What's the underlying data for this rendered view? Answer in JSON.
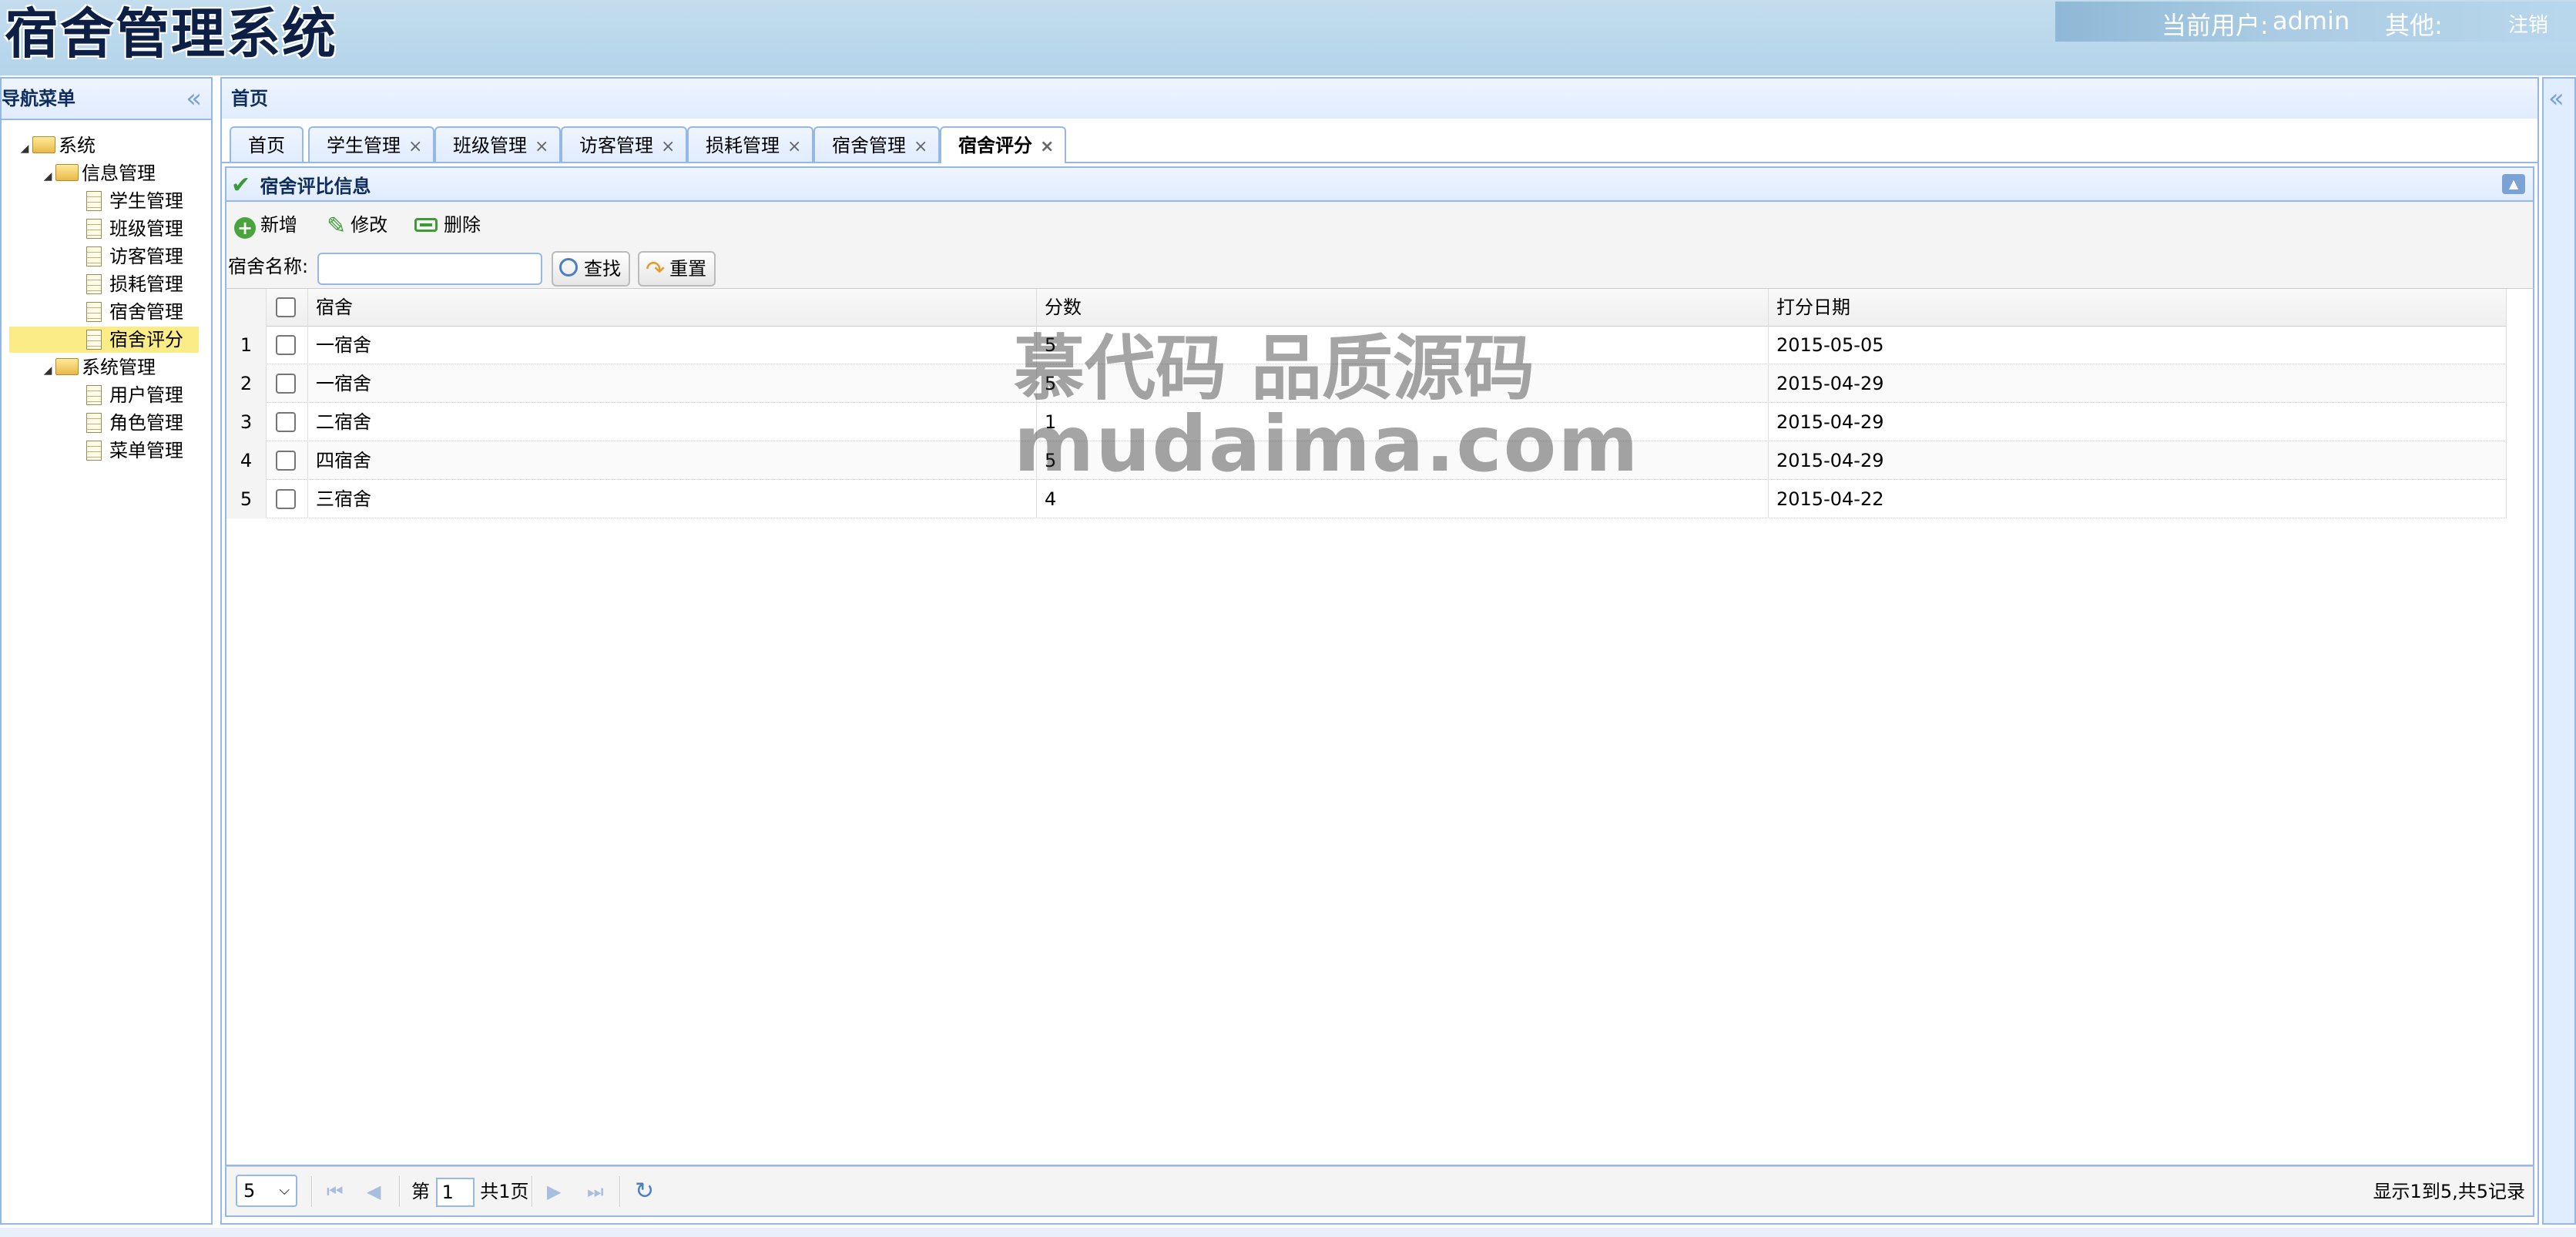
{
  "header": {
    "app_title": "宿舍管理系统",
    "current_user_label": "当前用户:",
    "current_user": "admin",
    "other_label": "其他:",
    "logout": "注销"
  },
  "nav": {
    "title": "导航菜单",
    "tree": [
      {
        "label": "系统",
        "type": "folder",
        "level": 0
      },
      {
        "label": "信息管理",
        "type": "folder",
        "level": 1
      },
      {
        "label": "学生管理",
        "type": "file",
        "level": 2
      },
      {
        "label": "班级管理",
        "type": "file",
        "level": 2
      },
      {
        "label": "访客管理",
        "type": "file",
        "level": 2
      },
      {
        "label": "损耗管理",
        "type": "file",
        "level": 2
      },
      {
        "label": "宿舍管理",
        "type": "file",
        "level": 2
      },
      {
        "label": "宿舍评分",
        "type": "file",
        "level": 2,
        "selected": true
      },
      {
        "label": "系统管理",
        "type": "folder",
        "level": 1
      },
      {
        "label": "用户管理",
        "type": "file",
        "level": 2
      },
      {
        "label": "角色管理",
        "type": "file",
        "level": 2
      },
      {
        "label": "菜单管理",
        "type": "file",
        "level": 2
      }
    ]
  },
  "center": {
    "title": "首页",
    "tabs": [
      {
        "label": "首页",
        "closable": false
      },
      {
        "label": "学生管理",
        "closable": true
      },
      {
        "label": "班级管理",
        "closable": true
      },
      {
        "label": "访客管理",
        "closable": true
      },
      {
        "label": "损耗管理",
        "closable": true
      },
      {
        "label": "宿舍管理",
        "closable": true
      },
      {
        "label": "宿舍评分",
        "closable": true,
        "active": true
      }
    ],
    "close_glyph": "×"
  },
  "panel": {
    "title": "宿舍评比信息",
    "toolbar": {
      "add": "新增",
      "edit": "修改",
      "delete": "删除"
    },
    "search": {
      "label": "宿舍名称:",
      "value": "",
      "search_btn": "查找",
      "reset_btn": "重置"
    }
  },
  "grid": {
    "columns": [
      "宿舍",
      "分数",
      "打分日期"
    ],
    "rows": [
      {
        "num": "1",
        "dorm": "一宿舍",
        "score": "5",
        "date": "2015-05-05"
      },
      {
        "num": "2",
        "dorm": "一宿舍",
        "score": "5",
        "date": "2015-04-29"
      },
      {
        "num": "3",
        "dorm": "二宿舍",
        "score": "1",
        "date": "2015-04-29"
      },
      {
        "num": "4",
        "dorm": "四宿舍",
        "score": "5",
        "date": "2015-04-29"
      },
      {
        "num": "5",
        "dorm": "三宿舍",
        "score": "4",
        "date": "2015-04-22"
      }
    ]
  },
  "pager": {
    "page_size": "5",
    "page_prefix": "第",
    "page_value": "1",
    "page_total": "共1页",
    "summary": "显示1到5,共5记录"
  },
  "watermark": {
    "line1": "慕代码 品质源码",
    "line2": "mudaima.com"
  }
}
